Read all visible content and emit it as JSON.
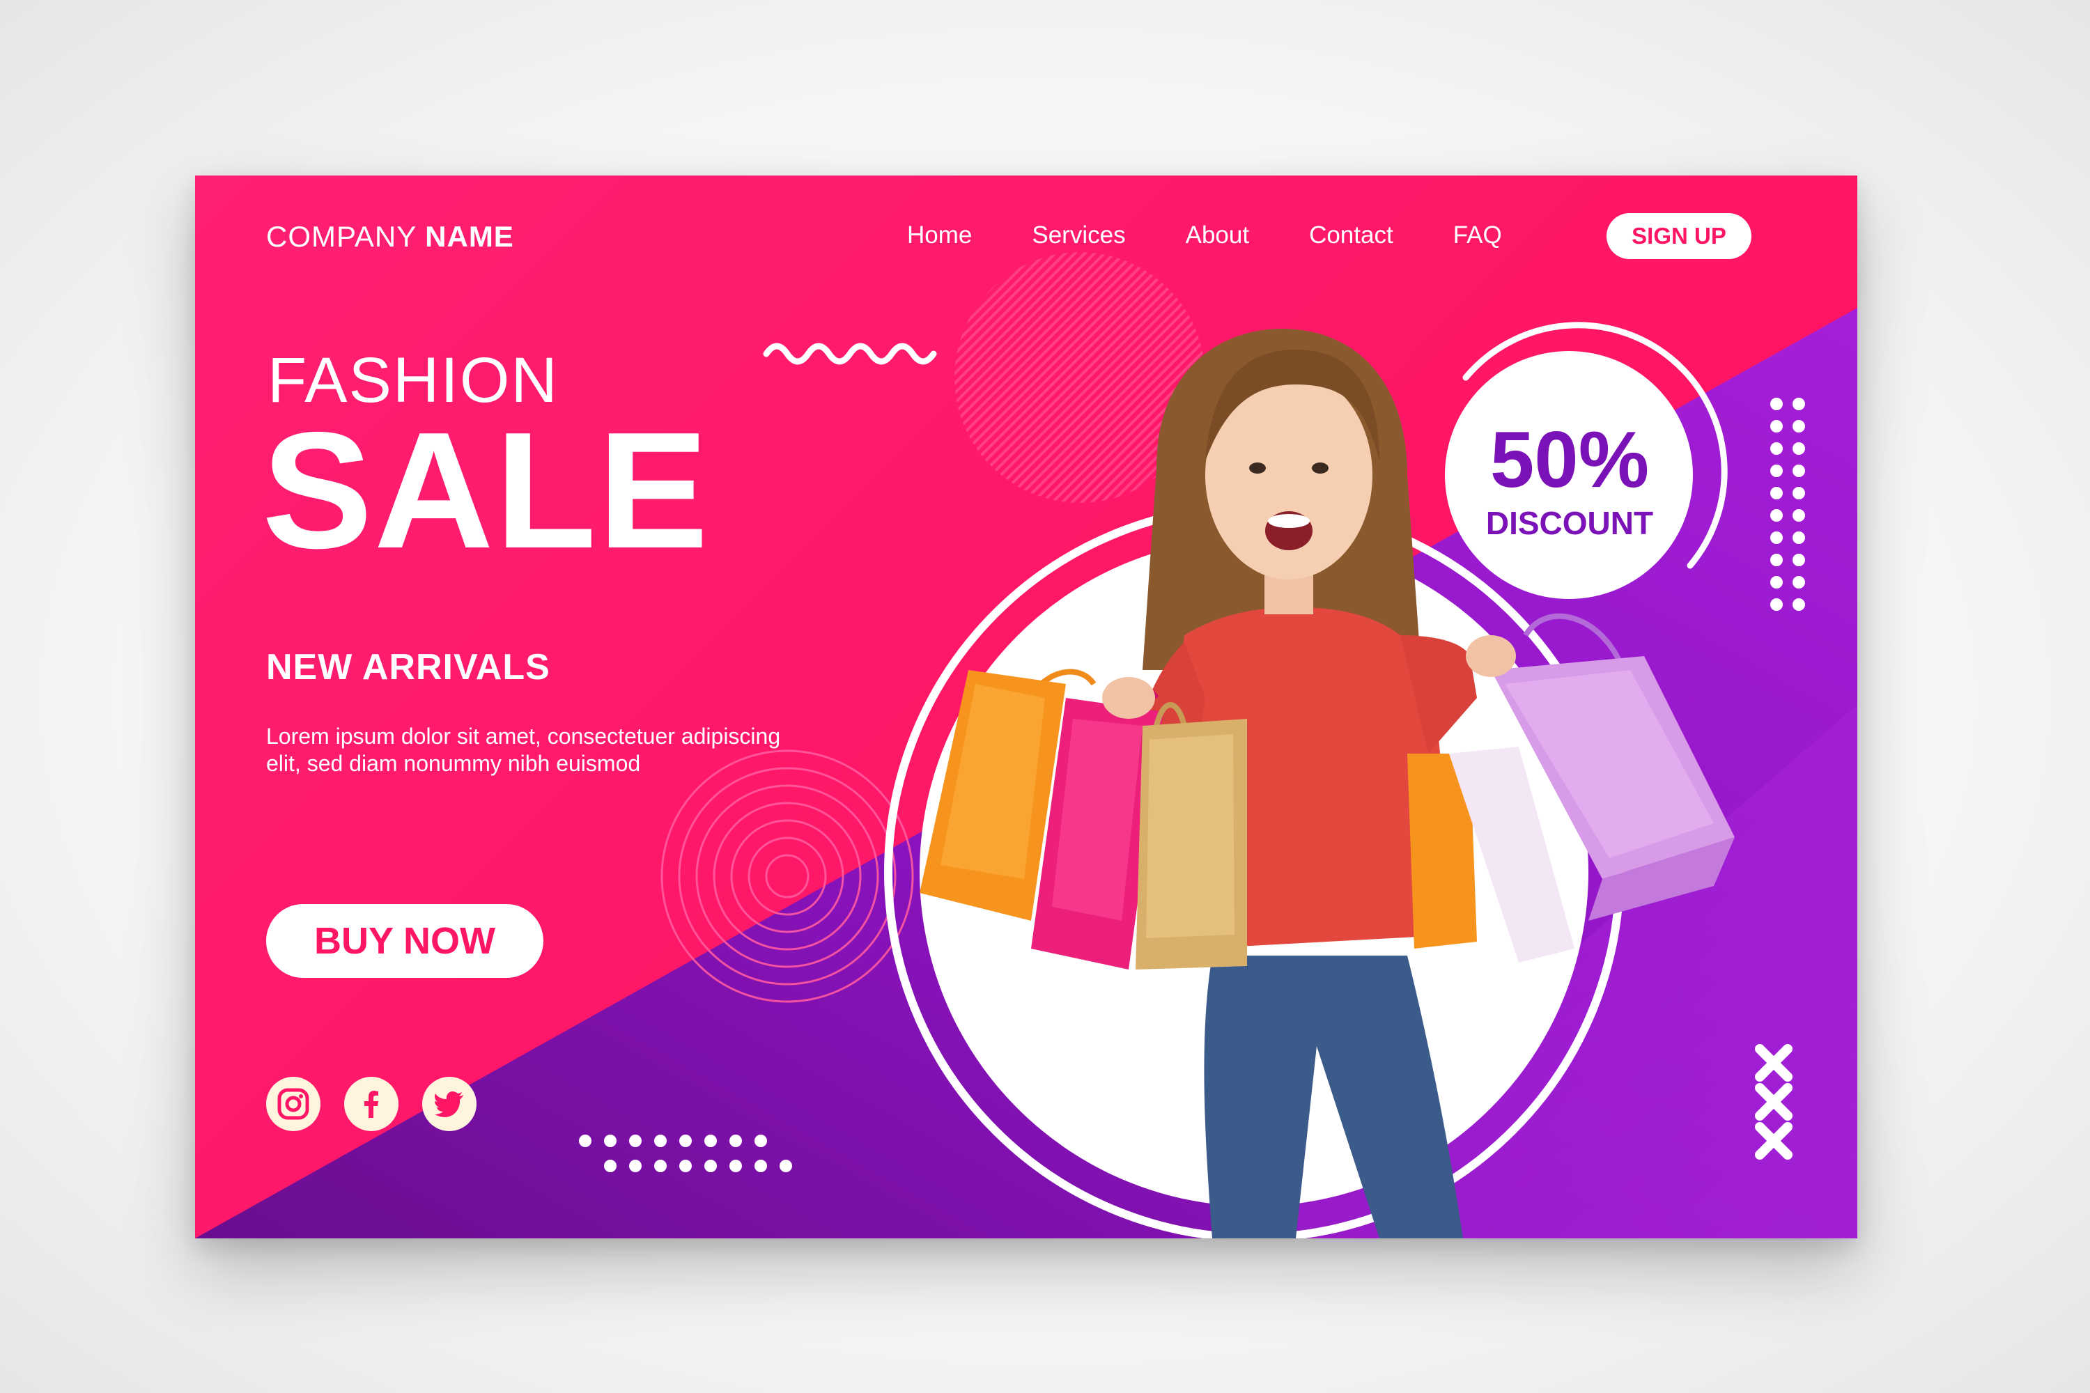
{
  "header": {
    "logo_regular": "COMPANY",
    "logo_bold": "NAME",
    "nav": [
      "Home",
      "Services",
      "About",
      "Contact",
      "FAQ"
    ],
    "signup_label": "SIGN UP"
  },
  "hero": {
    "kicker": "FASHION",
    "headline": "SALE",
    "subheading": "NEW ARRIVALS",
    "description": "Lorem ipsum dolor sit amet, consectetuer adipiscing elit, sed diam nonummy nibh euismod",
    "cta_label": "BUY NOW"
  },
  "discount": {
    "value": "50%",
    "label": "DISCOUNT"
  },
  "social": [
    "instagram-icon",
    "facebook-icon",
    "twitter-icon"
  ],
  "colors": {
    "pink": "#ff1565",
    "purple": "#8c16c8",
    "white": "#ffffff",
    "icon_bg": "#fff5df"
  },
  "photo": {
    "subject": "woman with shopping bags"
  }
}
